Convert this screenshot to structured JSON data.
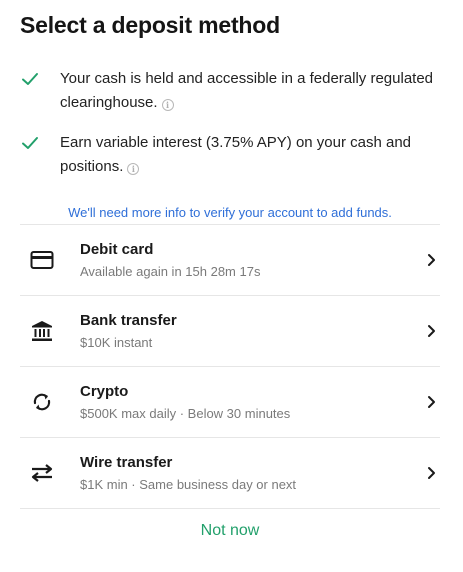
{
  "title": "Select a deposit method",
  "features": [
    {
      "text": "Your cash is held and accessible in a federally regulated clearinghouse.",
      "icon": "check-icon"
    },
    {
      "text": "Earn variable interest (3.75% APY) on your cash and positions.",
      "icon": "check-icon"
    }
  ],
  "verify_link": "We'll need more info to verify your account to add funds.",
  "methods": [
    {
      "title": "Debit card",
      "subtitle": "Available again in 15h 28m 17s",
      "icon": "credit-card-icon"
    },
    {
      "title": "Bank transfer",
      "subtitle": "$10K instant",
      "icon": "bank-icon"
    },
    {
      "title": "Crypto",
      "subtitle": "$500K max daily · Below 30 minutes",
      "icon": "sync-icon"
    },
    {
      "title": "Wire transfer",
      "subtitle": "$1K min · Same business day or next",
      "icon": "transfer-arrows-icon"
    }
  ],
  "not_now": "Not now",
  "colors": {
    "accent_green": "#22a06b",
    "link_blue": "#2f6fd8",
    "divider": "#e6e6e6"
  }
}
